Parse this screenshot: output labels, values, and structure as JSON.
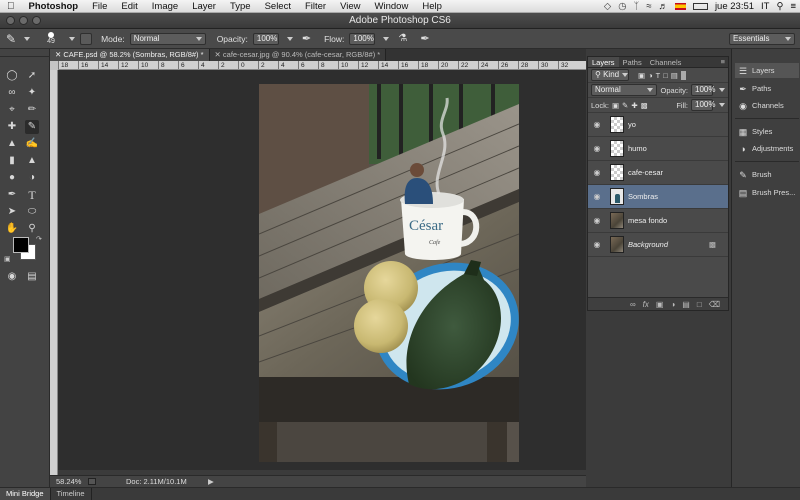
{
  "menubar": {
    "apple": "",
    "items": [
      "Photoshop",
      "File",
      "Edit",
      "Image",
      "Layer",
      "Type",
      "Select",
      "Filter",
      "View",
      "Window",
      "Help"
    ],
    "clock": "jue 23:51",
    "lang": "IT"
  },
  "window": {
    "title": "Adobe Photoshop CS6"
  },
  "options_bar": {
    "brush_size": "49",
    "mode_label": "Mode:",
    "mode_value": "Normal",
    "opacity_label": "Opacity:",
    "opacity_value": "100%",
    "flow_label": "Flow:",
    "flow_value": "100%",
    "workspace": "Essentials"
  },
  "doc_tabs": [
    {
      "label": "CAFE.psd @ 58.2% (Sombras, RGB/8#) *",
      "active": true
    },
    {
      "label": "cafe-cesar.jpg @ 90.4% (cafe-cesar, RGB/8#) *",
      "active": false
    }
  ],
  "ruler_ticks": [
    "18",
    "16",
    "14",
    "12",
    "10",
    "8",
    "6",
    "4",
    "2",
    "0",
    "2",
    "4",
    "6",
    "8",
    "10",
    "12",
    "14",
    "16",
    "18",
    "20",
    "22",
    "24",
    "26",
    "28",
    "30",
    "32"
  ],
  "mug_text": {
    "name": "César",
    "sub": "Cafe"
  },
  "status": {
    "zoom": "58.24%",
    "doc": "Doc: 2.11M/10.1M"
  },
  "bottom_tabs": [
    "Mini Bridge",
    "Timeline"
  ],
  "layers_panel": {
    "tabs": [
      "Layers",
      "Paths",
      "Channels"
    ],
    "kind_label": "Kind",
    "blend_mode": "Normal",
    "opacity_label": "Opacity:",
    "opacity_value": "100%",
    "lock_label": "Lock:",
    "fill_label": "Fill:",
    "fill_value": "100%",
    "layers": [
      {
        "name": "yo",
        "thumb": "transparent",
        "selected": false
      },
      {
        "name": "humo",
        "thumb": "transparent",
        "selected": false
      },
      {
        "name": "cafe-cesar",
        "thumb": "transparent",
        "selected": false
      },
      {
        "name": "Sombras",
        "thumb": "person",
        "selected": true
      },
      {
        "name": "mesa fondo",
        "thumb": "photo",
        "selected": false
      },
      {
        "name": "Background",
        "thumb": "photo",
        "selected": false,
        "locked": true
      }
    ]
  },
  "dock": {
    "items": [
      {
        "label": "Layers",
        "icon": "layers-icon",
        "active": true
      },
      {
        "label": "Paths",
        "icon": "paths-icon",
        "active": false
      },
      {
        "label": "Channels",
        "icon": "channels-icon",
        "active": false
      },
      {
        "label": "Styles",
        "icon": "styles-icon",
        "active": false
      },
      {
        "label": "Adjustments",
        "icon": "adjustments-icon",
        "active": false
      },
      {
        "label": "Brush",
        "icon": "brush-icon",
        "active": false
      },
      {
        "label": "Brush Pres...",
        "icon": "brush-presets-icon",
        "active": false
      }
    ]
  },
  "colors": {
    "selected_layer": "#5a6f8c",
    "panel_bg": "#4a4a4a",
    "plate_rim": "#2f86c4"
  }
}
